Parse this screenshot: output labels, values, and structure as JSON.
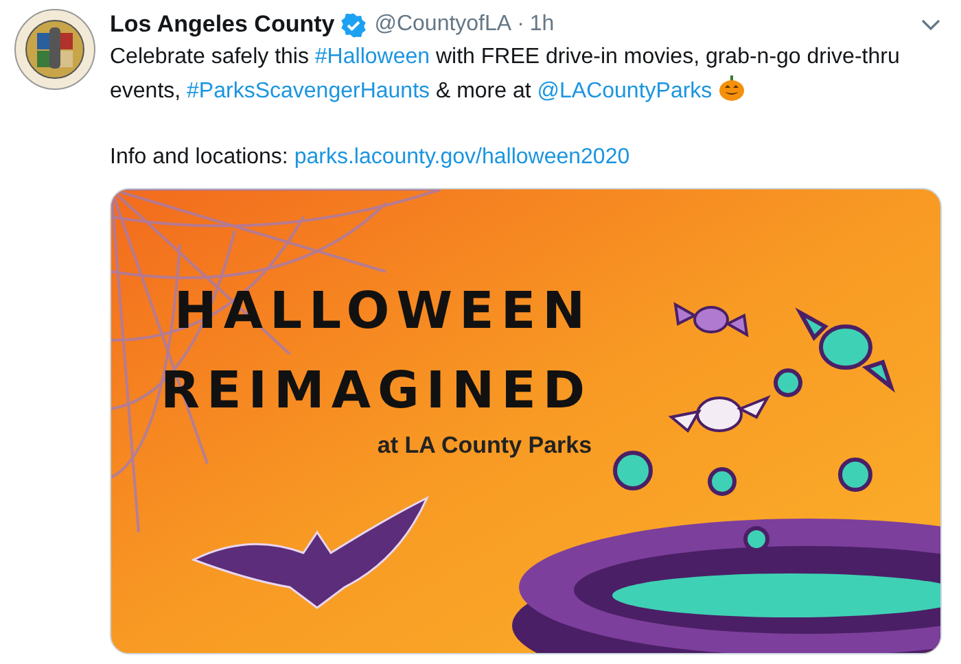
{
  "tweet": {
    "author": "Los Angeles County",
    "verified": true,
    "handle": "@CountyofLA",
    "separator": "·",
    "time": "1h",
    "body": [
      {
        "kind": "text",
        "text": "Celebrate safely this "
      },
      {
        "kind": "link",
        "text": "#Halloween"
      },
      {
        "kind": "text",
        "text": " with FREE drive-in movies, grab-n-go drive-thru events, "
      },
      {
        "kind": "link",
        "text": "#ParksScavengerHaunts"
      },
      {
        "kind": "text",
        "text": " & more at "
      },
      {
        "kind": "link",
        "text": "@LACountyParks"
      },
      {
        "kind": "emoji"
      }
    ],
    "info": [
      {
        "kind": "text",
        "text": "Info and locations: "
      },
      {
        "kind": "link",
        "text": "parks.lacounty.gov/halloween2020"
      }
    ],
    "image": {
      "headline": [
        "HALLOWEEN",
        "REIMAGINED"
      ],
      "subtitle": "at LA County Parks"
    }
  }
}
